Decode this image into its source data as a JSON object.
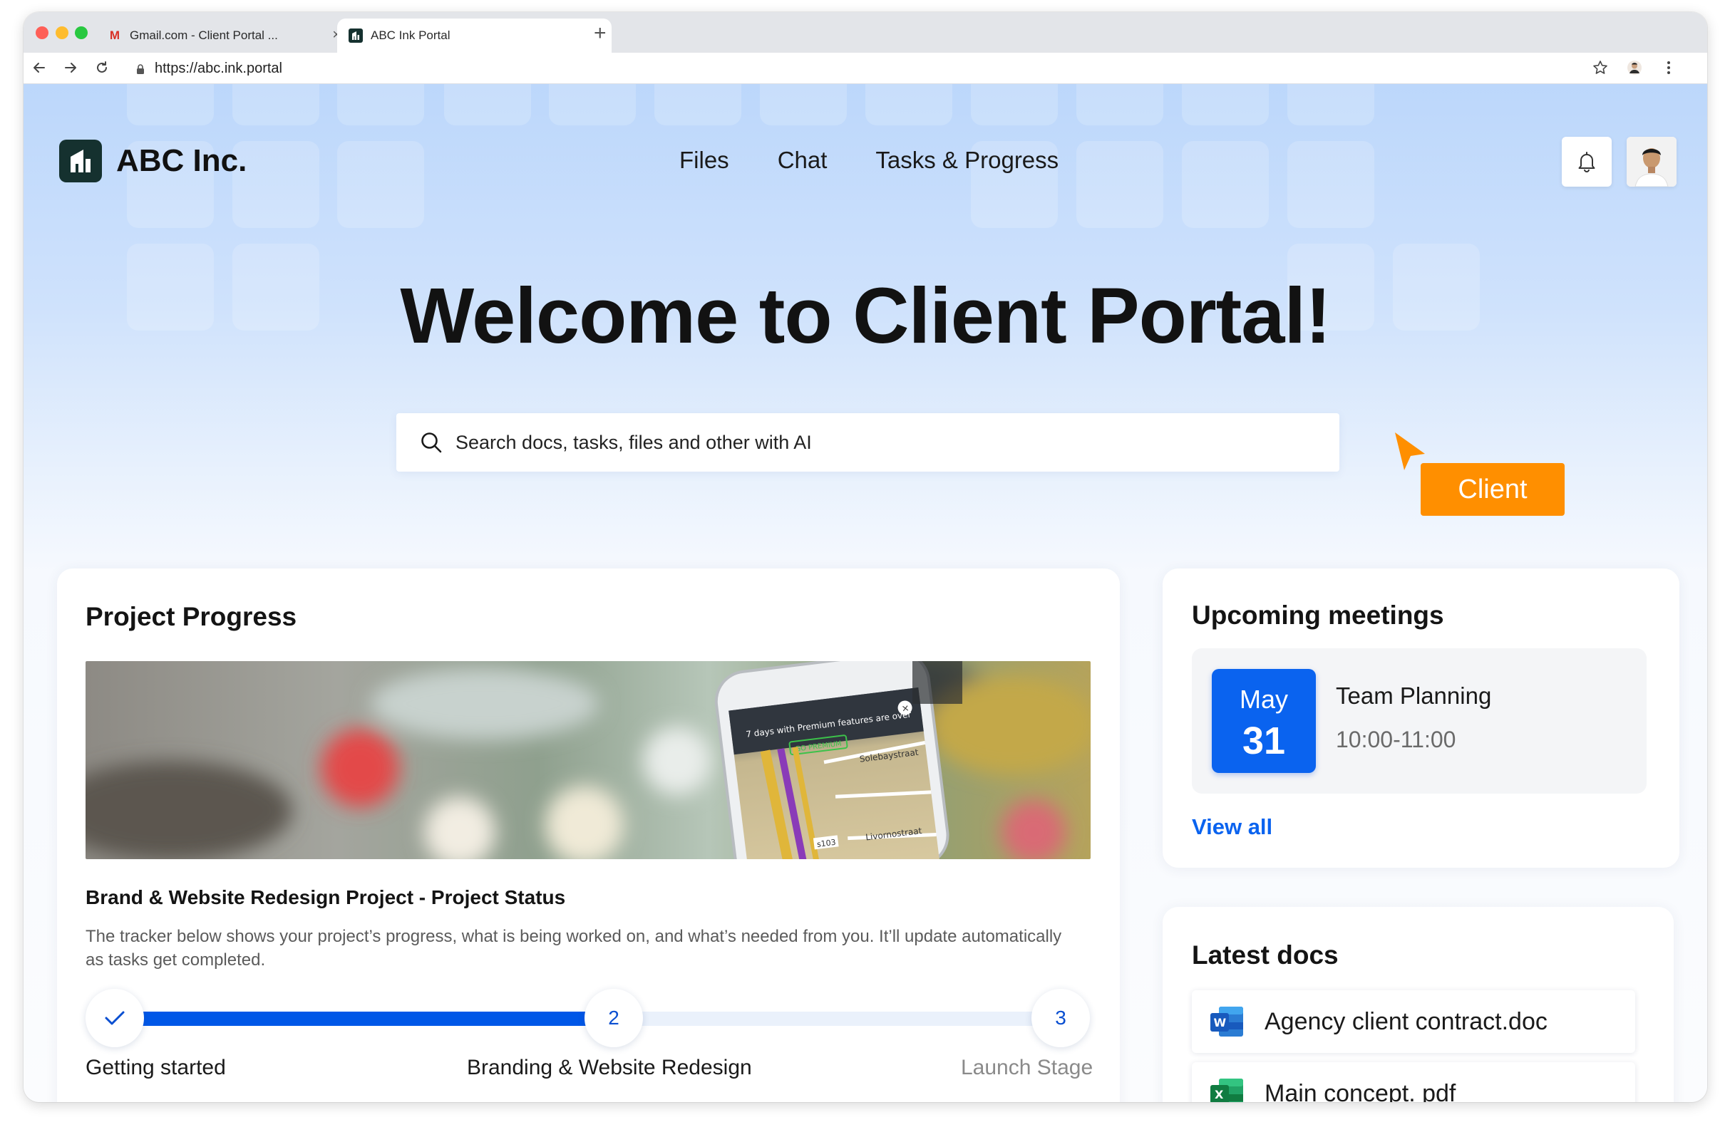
{
  "browser": {
    "tabs": [
      {
        "label": "Gmail.com - Client Portal ...",
        "icon": "gmail-icon"
      },
      {
        "label": "ABC Ink Portal",
        "icon": "abc-favicon"
      }
    ],
    "url": "https://abc.ink.portal"
  },
  "header": {
    "brand": "ABC Inc.",
    "nav": [
      {
        "label": "Files"
      },
      {
        "label": "Chat"
      },
      {
        "label": "Tasks & Progress"
      }
    ]
  },
  "hero": {
    "title": "Welcome to Client Portal!",
    "search_placeholder": "Search docs, tasks, files and other with AI"
  },
  "cursor_badge": {
    "label": "Client",
    "color": "#ff8f00"
  },
  "project_progress": {
    "title": "Project Progress",
    "heading": "Brand & Website Redesign Project - Project Status",
    "description": "The tracker below shows your project’s progress, what is being worked on, and what’s needed from you. It’ll update automatically as tasks get completed.",
    "progress_fraction": 0.5,
    "steps": [
      {
        "marker": "✓",
        "label": "Getting started",
        "state": "done"
      },
      {
        "marker": "2",
        "label": "Branding & Website Redesign",
        "state": "current"
      },
      {
        "marker": "3",
        "label": "Launch Stage",
        "state": "upcoming"
      }
    ],
    "banner_phone_text": {
      "promo": "7 days with Premium features are over",
      "cta": "GO PREMIUM",
      "street1": "Solebaystraat",
      "street2": "Livornostraat",
      "road": "s103"
    }
  },
  "meetings": {
    "title": "Upcoming meetings",
    "items": [
      {
        "month": "May",
        "day": "31",
        "name": "Team Planning",
        "time": "10:00-11:00"
      }
    ],
    "view_all": "View all"
  },
  "docs": {
    "title": "Latest docs",
    "items": [
      {
        "name": "Agency client contract.doc",
        "icon": "word-icon",
        "letter": "W"
      },
      {
        "name": "Main concept. pdf",
        "icon": "excel-icon",
        "letter": "X"
      }
    ]
  },
  "colors": {
    "accent": "#0a63ef",
    "progress": "#0057e7",
    "brand_dark": "#15312f",
    "badge": "#ff8f00"
  }
}
